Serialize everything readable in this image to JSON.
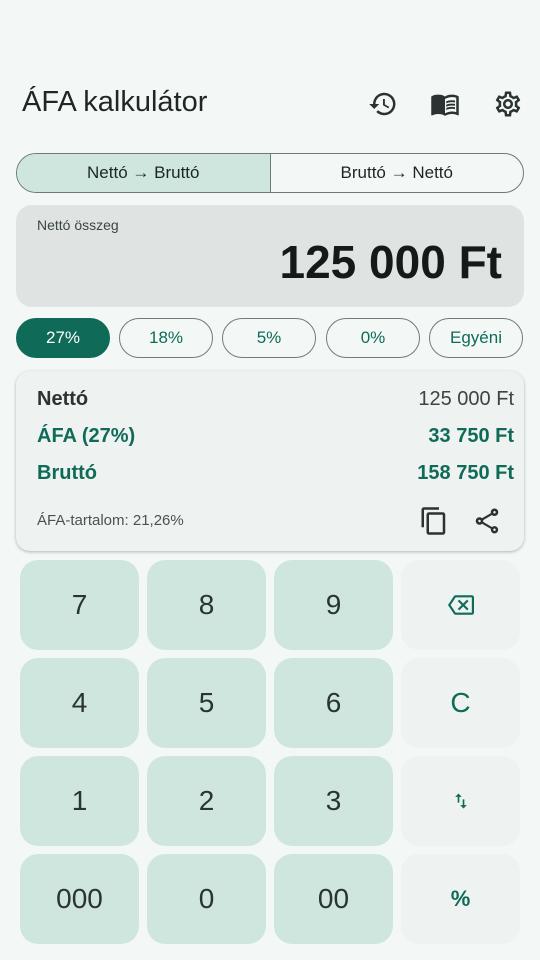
{
  "header": {
    "title": "ÁFA kalkulátor",
    "icons": [
      "history-icon",
      "book-icon",
      "gear-icon"
    ]
  },
  "mode": {
    "options": [
      "Nettó → Bruttó",
      "Bruttó → Nettó"
    ],
    "selected": "Nettó → Bruttó"
  },
  "amount": {
    "label": "Nettó összeg",
    "value": "125 000 Ft"
  },
  "rates": {
    "options": [
      "27%",
      "18%",
      "5%",
      "0%",
      "Egyéni"
    ],
    "selected": "27%"
  },
  "result": {
    "rows": [
      {
        "label": "Nettó",
        "value": "125 000 Ft"
      },
      {
        "label": "ÁFA (27%)",
        "value": "33 750 Ft"
      },
      {
        "label": "Bruttó",
        "value": "158 750 Ft"
      }
    ],
    "vat_content": "ÁFA-tartalom: 21,26%",
    "icons": [
      "copy-icon",
      "share-icon"
    ]
  },
  "keypad": {
    "keys": [
      "7",
      "8",
      "9",
      "backspace",
      "4",
      "5",
      "6",
      "C",
      "1",
      "2",
      "3",
      "swap",
      "000",
      "0",
      "00",
      "%"
    ]
  },
  "colors": {
    "accent": "#0f6b58",
    "key_background": "#cfe6df",
    "function_key_background": "#eef2f1",
    "page_background": "#f3f8f6"
  }
}
